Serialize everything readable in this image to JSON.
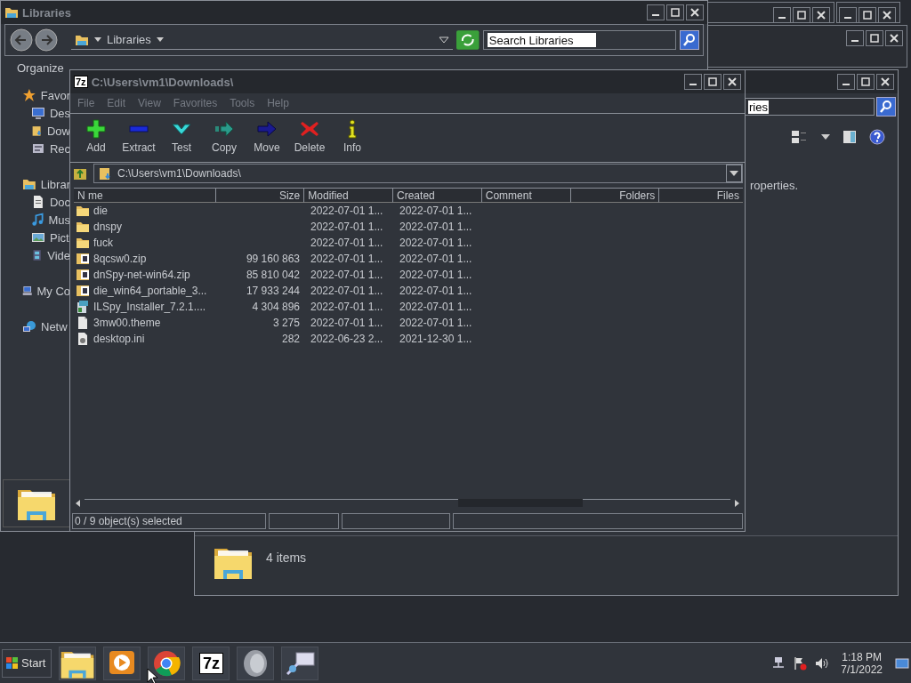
{
  "libraries_window": {
    "title": "Libraries",
    "address": "Libraries",
    "search": {
      "placeholder": "Search Libraries"
    },
    "toolbar": [
      "Organize"
    ],
    "sidebar": {
      "items": [
        {
          "label": "Favor",
          "kind": "star",
          "children": [
            {
              "label": "Des",
              "kind": "desktop"
            },
            {
              "label": "Dow",
              "kind": "downloads"
            },
            {
              "label": "Rec",
              "kind": "recent"
            }
          ]
        },
        {
          "label": "Librar",
          "kind": "library",
          "children": [
            {
              "label": "Doc",
              "kind": "document"
            },
            {
              "label": "Mus",
              "kind": "music"
            },
            {
              "label": "Pict",
              "kind": "pictures"
            },
            {
              "label": "Vide",
              "kind": "video"
            }
          ]
        },
        {
          "label": "My Co",
          "kind": "computer"
        },
        {
          "label": "Netw",
          "kind": "network"
        }
      ]
    }
  },
  "back_explorer": {
    "search_value": "ries",
    "details_text": "roperties.",
    "item_count": "4 items"
  },
  "archive_window": {
    "logo": "7z",
    "title": "C:\\Users\\vm1\\Downloads\\",
    "menu": [
      {
        "label": "File",
        "disabled": true
      },
      {
        "label": "Edit",
        "disabled": true
      },
      {
        "label": "View",
        "disabled": true
      },
      {
        "label": "Favorites",
        "disabled": true
      },
      {
        "label": "Tools",
        "disabled": true
      },
      {
        "label": "Help",
        "disabled": true
      }
    ],
    "toolbar": [
      {
        "label": "Add",
        "kind": "add"
      },
      {
        "label": "Extract",
        "kind": "extract"
      },
      {
        "label": "Test",
        "kind": "test"
      },
      {
        "label": "Copy",
        "kind": "copy"
      },
      {
        "label": "Move",
        "kind": "move"
      },
      {
        "label": "Delete",
        "kind": "delete"
      },
      {
        "label": "Info",
        "kind": "info"
      }
    ],
    "address": "C:\\Users\\vm1\\Downloads\\",
    "table": {
      "columns": [
        "N me",
        "Size",
        "Modified",
        "Created",
        "Comment",
        "Folders",
        "Files"
      ],
      "rows": [
        {
          "kind": "folder",
          "cells": [
            "die",
            "",
            "2022-07-01 1...",
            "2022-07-01 1..."
          ]
        },
        {
          "kind": "folder",
          "cells": [
            "dnspy",
            "",
            "2022-07-01 1...",
            "2022-07-01 1..."
          ]
        },
        {
          "kind": "folder",
          "cells": [
            "fuck",
            "",
            "2022-07-01 1...",
            "2022-07-01 1..."
          ]
        },
        {
          "kind": "zip",
          "cells": [
            "8qcsw0.zip",
            "99 160 863",
            "2022-07-01 1...",
            "2022-07-01 1..."
          ]
        },
        {
          "kind": "zip",
          "cells": [
            "dnSpy-net-win64.zip",
            "85 810 042",
            "2022-07-01 1...",
            "2022-07-01 1..."
          ]
        },
        {
          "kind": "zip",
          "cells": [
            "die_win64_portable_3...",
            "17 933 244",
            "2022-07-01 1...",
            "2022-07-01 1..."
          ]
        },
        {
          "kind": "installer",
          "cells": [
            "ILSpy_Installer_7.2.1....",
            "4 304 896",
            "2022-07-01 1...",
            "2022-07-01 1..."
          ]
        },
        {
          "kind": "file",
          "cells": [
            "3mw00.theme",
            "3 275",
            "2022-07-01 1...",
            "2022-07-01 1..."
          ]
        },
        {
          "kind": "settings",
          "cells": [
            "desktop.ini",
            "282",
            "2022-06-23 2...",
            "2021-12-30 1..."
          ]
        }
      ]
    },
    "status_bar": [
      "0 / 9 object(s) selected"
    ]
  },
  "taskbar": {
    "start": "Start",
    "apps": [
      {
        "kind": "explorer"
      },
      {
        "kind": "media"
      },
      {
        "kind": "browser"
      },
      {
        "kind": "archiver",
        "label": "7z"
      },
      {
        "kind": "speaker"
      },
      {
        "kind": "display"
      }
    ],
    "tray": [
      {
        "kind": "network"
      },
      {
        "kind": "flag"
      },
      {
        "kind": "volume"
      }
    ],
    "clock": {
      "time": "1:18 PM",
      "date": "7/1/2022"
    }
  }
}
